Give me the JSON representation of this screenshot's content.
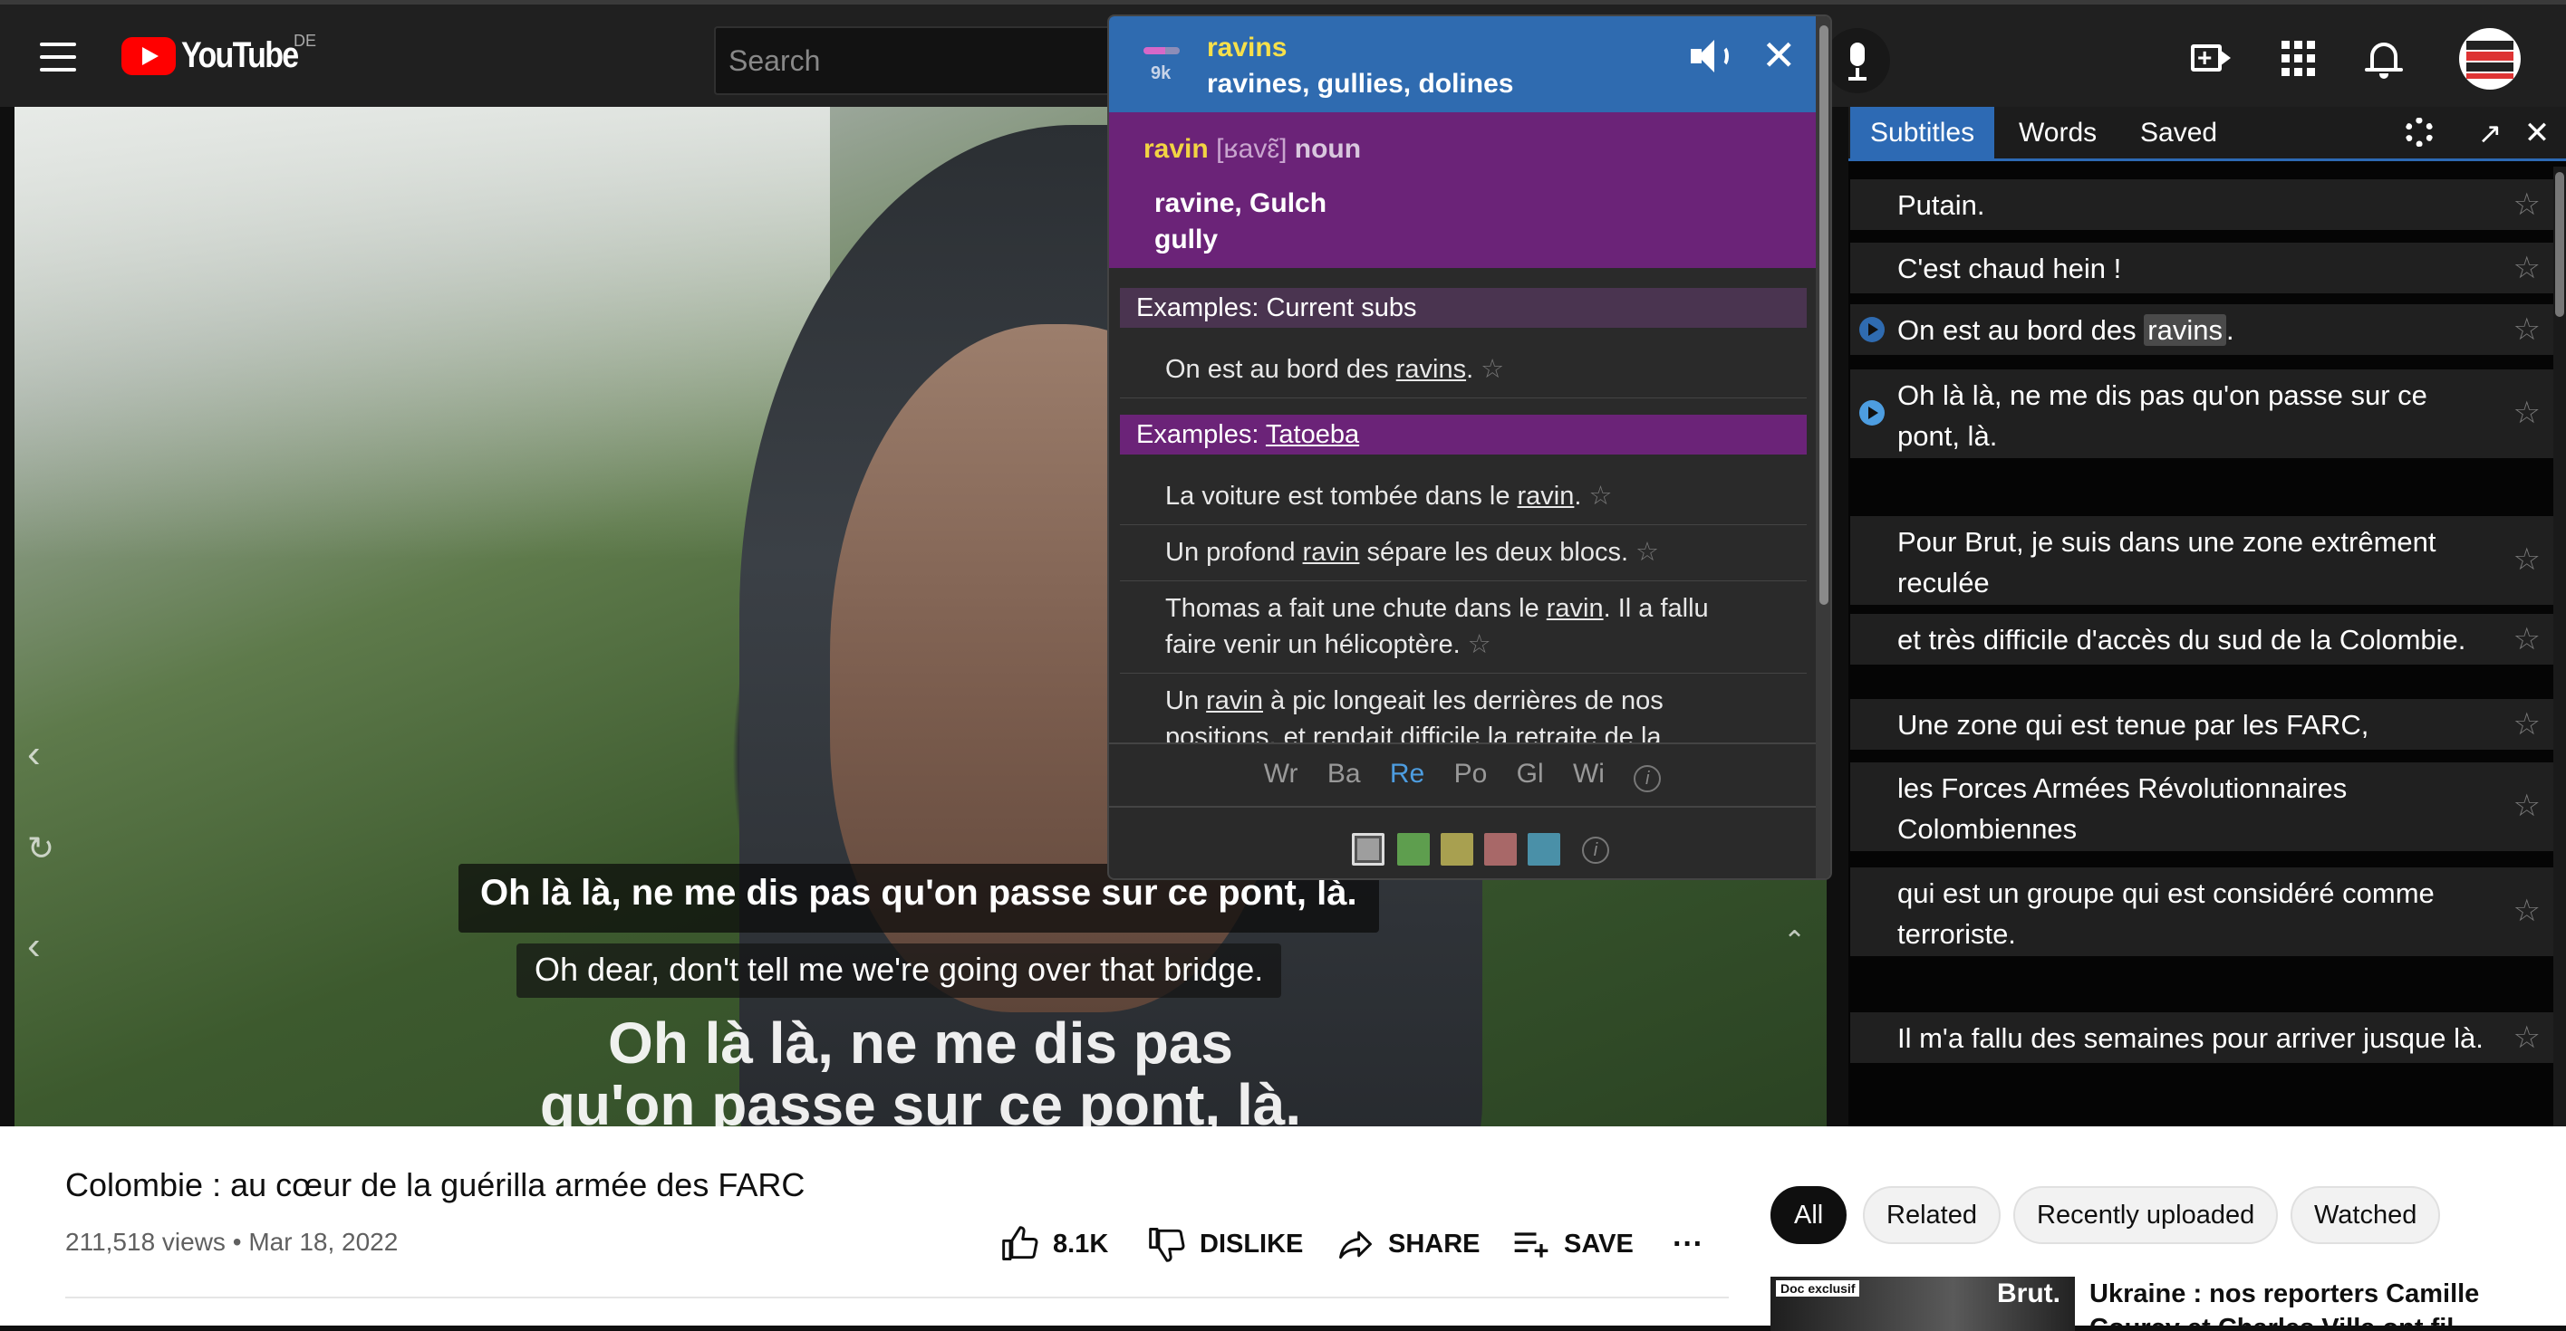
{
  "header": {
    "logo_text": "YouTube",
    "country_code": "DE",
    "search_placeholder": "Search"
  },
  "video": {
    "burned_caption_line1": "Oh là là, ne me dis pas",
    "burned_caption_line2": "qu'on passe sur ce pont, là.",
    "subtitle_original": "Oh là là, ne me dis pas qu'on passe sur ce pont, là.",
    "subtitle_translation": "Oh dear, don't tell me we're going over that bridge."
  },
  "popup": {
    "frequency_label": "9k",
    "word": "ravins",
    "translations": "ravines, gullies, dolines",
    "definition": {
      "lemma": "ravin",
      "ipa": "[ʁavɛ̃]",
      "pos": "noun",
      "meaning_1": "ravine, Gulch",
      "meaning_2": "gully"
    },
    "section_current": "Examples: Current subs",
    "current_examples": [
      {
        "before": "On est au bord des ",
        "word": "ravins",
        "after": "."
      }
    ],
    "section_tatoeba_prefix": "Examples: ",
    "section_tatoeba_link": "Tatoeba",
    "tatoeba_examples": [
      {
        "before": "La voiture est tombée dans le ",
        "word": "ravin",
        "after": "."
      },
      {
        "before": "Un profond ",
        "word": "ravin",
        "after": " sépare les deux blocs."
      },
      {
        "before": "Thomas a fait une chute dans le ",
        "word": "ravin",
        "after": ". Il a fallu faire venir un hélicoptère."
      },
      {
        "before": "Un ",
        "word": "ravin",
        "after": " à pic longeait les derrières de nos positions, et rendait difficile la retraite de la"
      }
    ],
    "tools": [
      "Wr",
      "Ba",
      "Re",
      "Po",
      "Gl",
      "Wi"
    ],
    "active_tool": "Re",
    "swatch_colors": [
      "#9e9e9e",
      "#5e9e4e",
      "#a8a050",
      "#a86868",
      "#4a90a8"
    ],
    "info_symbol": "i",
    "star_symbol": "☆",
    "close_symbol": "✕"
  },
  "panel": {
    "tabs": [
      "Subtitles",
      "Words",
      "Saved"
    ],
    "active_tab": "Subtitles",
    "star_symbol": "☆",
    "close_symbol": "✕",
    "rows": [
      {
        "text": "Putain."
      },
      {
        "text": "C'est chaud hein !"
      },
      {
        "before": "On est au bord des ",
        "hl": "ravins",
        "after": "."
      },
      {
        "text": "Oh là là, ne me dis pas qu'on passe sur ce pont, là."
      },
      {
        "text": "Pour Brut, je suis dans une zone extrêment reculée"
      },
      {
        "text": "et très difficile d'accès du sud de la Colombie."
      },
      {
        "text": "Une zone qui est tenue par les FARC,"
      },
      {
        "text": "les Forces Armées Révolutionnaires Colombiennes"
      },
      {
        "text": "qui est un groupe qui est considéré comme terroriste."
      },
      {
        "text": "Il m'a fallu des semaines pour arriver jusque là."
      }
    ]
  },
  "below": {
    "title": "Colombie : au cœur de la guérilla armée des FARC",
    "views": "211,518 views",
    "date": "Mar 18, 2022",
    "likes": "8.1K",
    "dislike_label": "DISLIKE",
    "share_label": "SHARE",
    "save_label": "SAVE",
    "more_symbol": "···",
    "chips": [
      "All",
      "Related",
      "Recently uploaded",
      "Watched"
    ],
    "rec_badge": "Doc exclusif",
    "rec_brand": "Brut.",
    "rec_title": "Ukraine : nos reporters Camille Courcy et Charles Villa ont fil..."
  },
  "colors": {
    "accent_blue": "#2f6bb0",
    "purple": "#6b2378",
    "youtube_red": "#ff0000"
  }
}
